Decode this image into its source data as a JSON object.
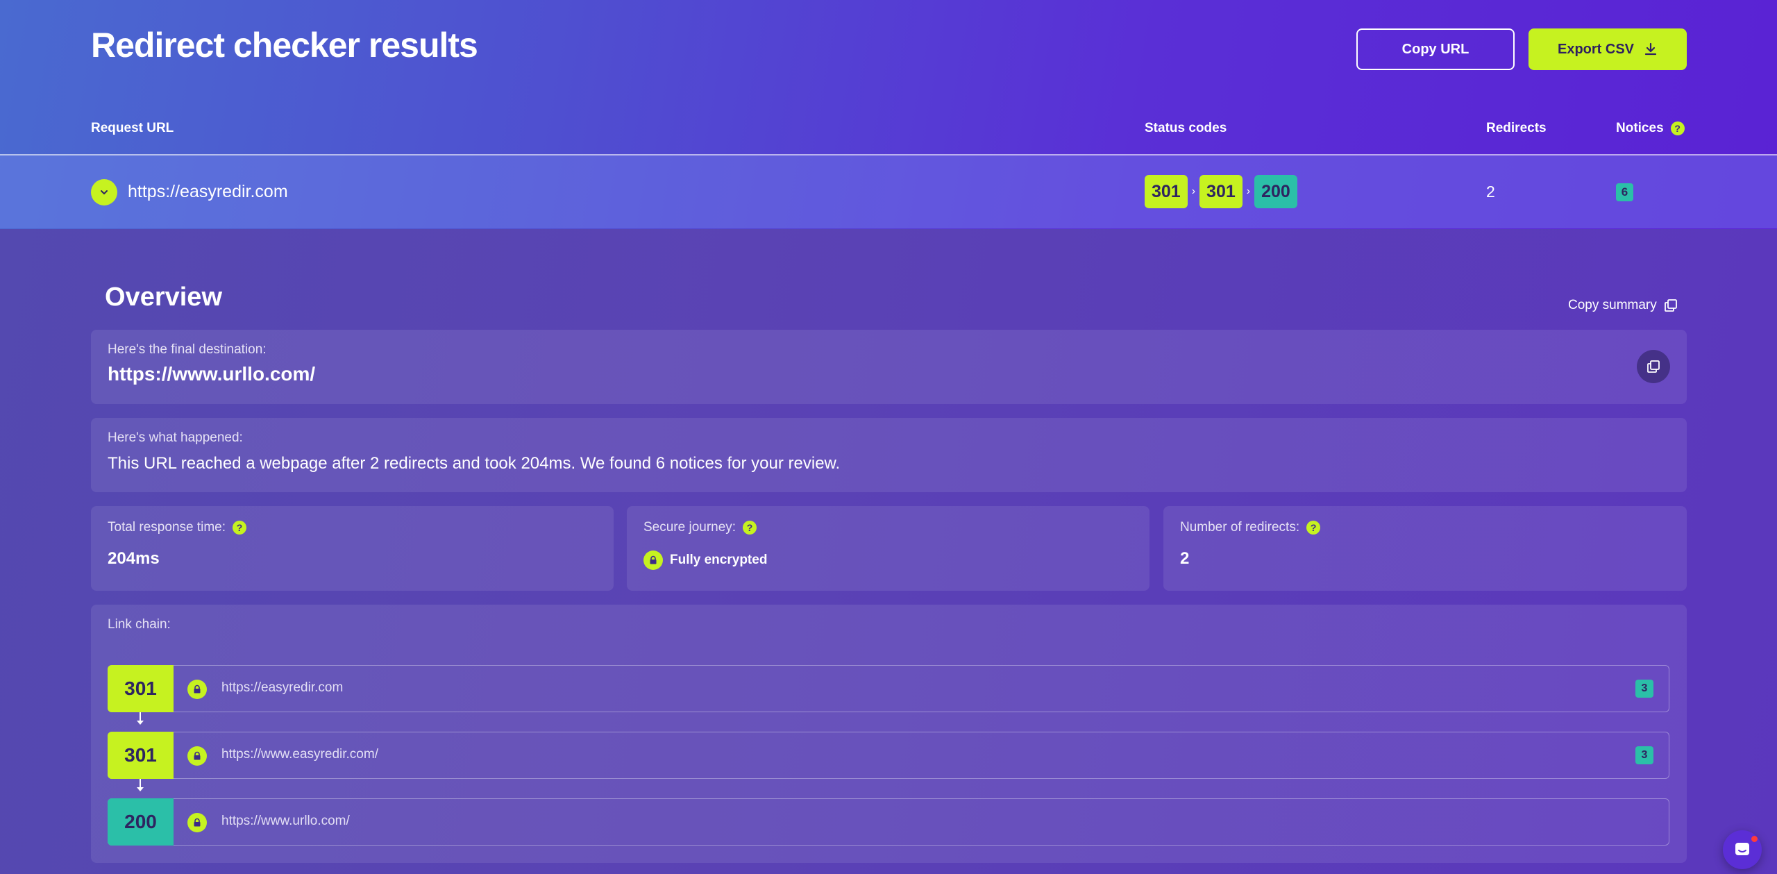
{
  "header": {
    "title": "Redirect checker results",
    "copy_url_label": "Copy URL",
    "export_csv_label": "Export CSV"
  },
  "table": {
    "columns": {
      "request_url": "Request URL",
      "status_codes": "Status codes",
      "redirects": "Redirects",
      "notices": "Notices"
    },
    "row": {
      "url": "https://easyredir.com",
      "status_codes": [
        "301",
        "301",
        "200"
      ],
      "chain_separator": "›",
      "redirects": "2",
      "notices": "6"
    }
  },
  "overview": {
    "title": "Overview",
    "copy_summary_label": "Copy summary",
    "final_destination": {
      "label": "Here's the final destination:",
      "url": "https://www.urllo.com/"
    },
    "what_happened": {
      "label": "Here's what happened:",
      "text": "This URL reached a webpage after 2 redirects and took 204ms. We found 6 notices for your review."
    },
    "response_time": {
      "label": "Total response time:",
      "value": "204ms"
    },
    "secure_journey": {
      "label": "Secure journey:",
      "value": "Fully encrypted"
    },
    "redirect_count": {
      "label": "Number of redirects:",
      "value": "2"
    },
    "link_chain": {
      "label": "Link chain:",
      "hops": [
        {
          "code": "301",
          "url": "https://easyredir.com",
          "notices": "3"
        },
        {
          "code": "301",
          "url": "https://www.easyredir.com/",
          "notices": "3"
        },
        {
          "code": "200",
          "url": "https://www.urllo.com/",
          "notices": ""
        }
      ]
    }
  },
  "help_glyph": "?",
  "colors": {
    "accent_lime": "#c6f220",
    "success_teal": "#2bbfa8",
    "text_dark": "#2e2460"
  }
}
